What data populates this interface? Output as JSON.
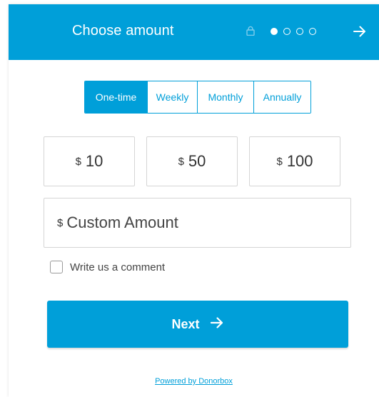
{
  "header": {
    "title": "Choose amount",
    "steps_total": 4,
    "current_step": 1
  },
  "frequency": {
    "options": [
      "One-time",
      "Weekly",
      "Monthly",
      "Annually"
    ],
    "selected": "One-time"
  },
  "amounts": [
    {
      "currency": "$",
      "value": "10"
    },
    {
      "currency": "$",
      "value": "50"
    },
    {
      "currency": "$",
      "value": "100"
    }
  ],
  "custom_amount": {
    "currency": "$",
    "placeholder": "Custom Amount",
    "value": ""
  },
  "comment": {
    "label": "Write us a comment",
    "checked": false
  },
  "next_button": {
    "label": "Next"
  },
  "footer": {
    "powered_by": "Powered by Donorbox"
  },
  "colors": {
    "accent": "#009fd9",
    "border": "#d5d5d5",
    "text": "#333333"
  },
  "icons": {
    "lock": "lock-icon",
    "arrow": "arrow-right-icon"
  }
}
